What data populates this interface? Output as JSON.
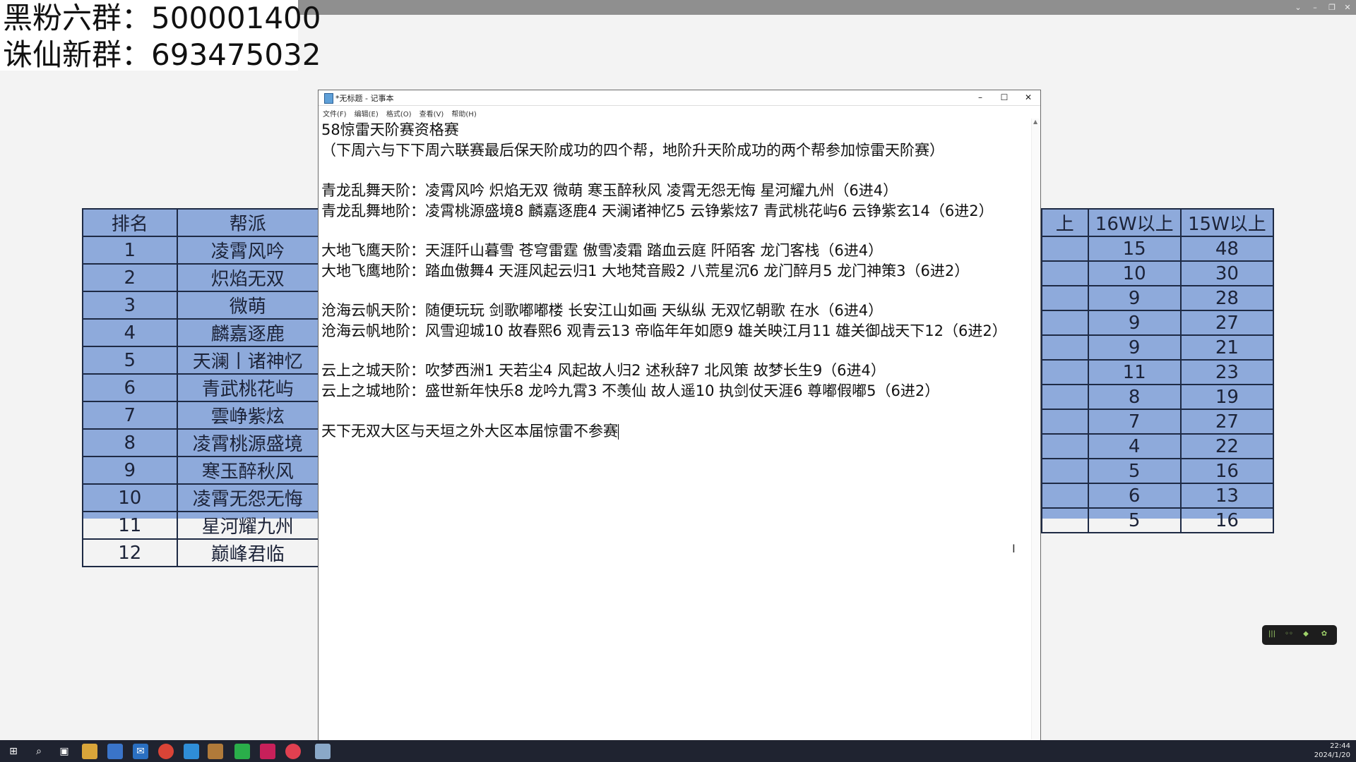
{
  "overlay": {
    "line1": "黑粉六群：500001400",
    "line2": "诛仙新群：693475032"
  },
  "bg_table_left": {
    "headers": [
      "排名",
      "帮派"
    ],
    "rows": [
      [
        "1",
        "凌霄风吟"
      ],
      [
        "2",
        "炽焰无双"
      ],
      [
        "3",
        "微萌"
      ],
      [
        "4",
        "麟嘉逐鹿"
      ],
      [
        "5",
        "天澜丨诸神忆"
      ],
      [
        "6",
        "青武桃花屿"
      ],
      [
        "7",
        "雲峥紫炫"
      ],
      [
        "8",
        "凌霄桃源盛境"
      ],
      [
        "9",
        "寒玉醉秋风"
      ],
      [
        "10",
        "凌霄无怨无悔"
      ],
      [
        "11",
        "星河耀九州"
      ],
      [
        "12",
        "巅峰君临"
      ]
    ]
  },
  "bg_table_right": {
    "headers": [
      "上",
      "16W以上",
      "15W以上"
    ],
    "rows": [
      [
        "",
        "15",
        "48"
      ],
      [
        "",
        "10",
        "30"
      ],
      [
        "",
        "9",
        "28"
      ],
      [
        "",
        "9",
        "27"
      ],
      [
        "",
        "9",
        "21"
      ],
      [
        "",
        "11",
        "23"
      ],
      [
        "",
        "8",
        "19"
      ],
      [
        "",
        "7",
        "27"
      ],
      [
        "",
        "4",
        "22"
      ],
      [
        "",
        "5",
        "16"
      ],
      [
        "",
        "6",
        "13"
      ],
      [
        "",
        "5",
        "16"
      ]
    ]
  },
  "notepad": {
    "title": "*无标题 - 记事本",
    "menu": [
      "文件(F)",
      "编辑(E)",
      "格式(O)",
      "查看(V)",
      "帮助(H)"
    ],
    "lines": [
      "58惊雷天阶赛资格赛",
      "（下周六与下下周六联赛最后保天阶成功的四个帮，地阶升天阶成功的两个帮参加惊雷天阶赛）",
      "",
      "青龙乱舞天阶：凌霄风吟 炽焰无双 微萌 寒玉醉秋风 凌霄无怨无悔 星河耀九州（6进4）",
      "青龙乱舞地阶：凌霄桃源盛境8 麟嘉逐鹿4 天澜诸神忆5 云铮紫炫7 青武桃花屿6 云铮紫玄14（6进2）",
      "",
      "大地飞鹰天阶：天涯阡山暮雪 苍穹雷霆 傲雪凌霜 踏血云庭 阡陌客 龙门客栈（6进4）",
      "大地飞鹰地阶：踏血傲舞4 天涯风起云归1 大地梵音殿2 八荒星沉6 龙门醉月5 龙门神策3（6进2）",
      "",
      "沧海云帆天阶：随便玩玩 剑歌嘟嘟楼 长安江山如画 天纵纵 无双忆朝歌 在水（6进4）",
      "沧海云帆地阶：风雪迎城10 故春熙6 观青云13 帝临年年如愿9 雄关映江月11 雄关御战天下12（6进2）",
      "",
      "云上之城天阶：吹梦西洲1 天若尘4 风起故人归2 述秋辞7 北风策 故梦长生9（6进4）",
      "云上之城地阶：盛世新年快乐8 龙吟九霄3 不羡仙 故人遥10 执剑仗天涯6 尊嘟假嘟5（6进2）",
      "",
      "天下无双大区与天垣之外大区本届惊雷不参赛"
    ]
  },
  "clock": {
    "time": "22:44",
    "date": "2024/1/20"
  }
}
